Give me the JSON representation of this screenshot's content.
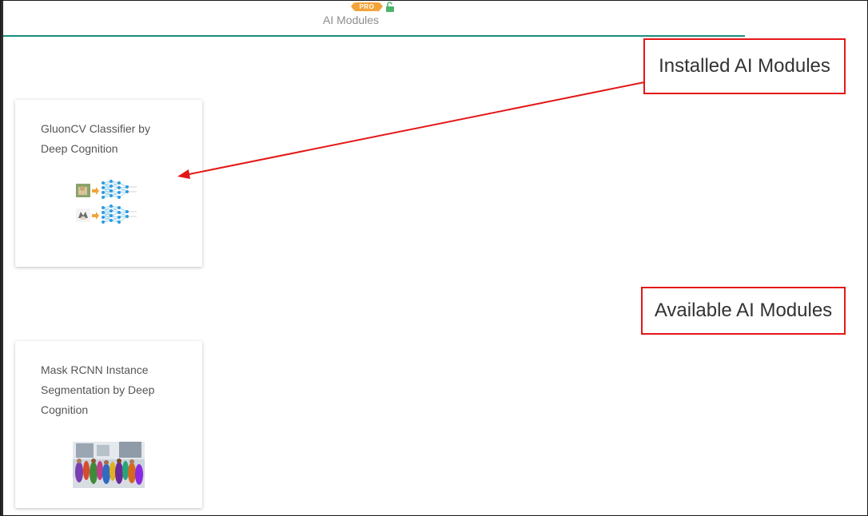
{
  "tab": {
    "badge": "PRO",
    "label": "AI Modules",
    "lock_icon": "lock-open-icon"
  },
  "colors": {
    "accent": "#1a8f7f",
    "badge": "#f2a43a",
    "callout_border": "#e41717"
  },
  "installed": {
    "callout_label": "Installed AI Modules",
    "modules": [
      {
        "title": "GluonCV Classifier by Deep Cognition",
        "thumbnail_icon": "neural-network-classifier-image"
      }
    ]
  },
  "available": {
    "callout_label": "Available AI Modules",
    "modules": [
      {
        "title": "Mask RCNN Instance Segmentation by Deep Cognition",
        "thumbnail_icon": "instance-segmentation-image"
      }
    ]
  }
}
